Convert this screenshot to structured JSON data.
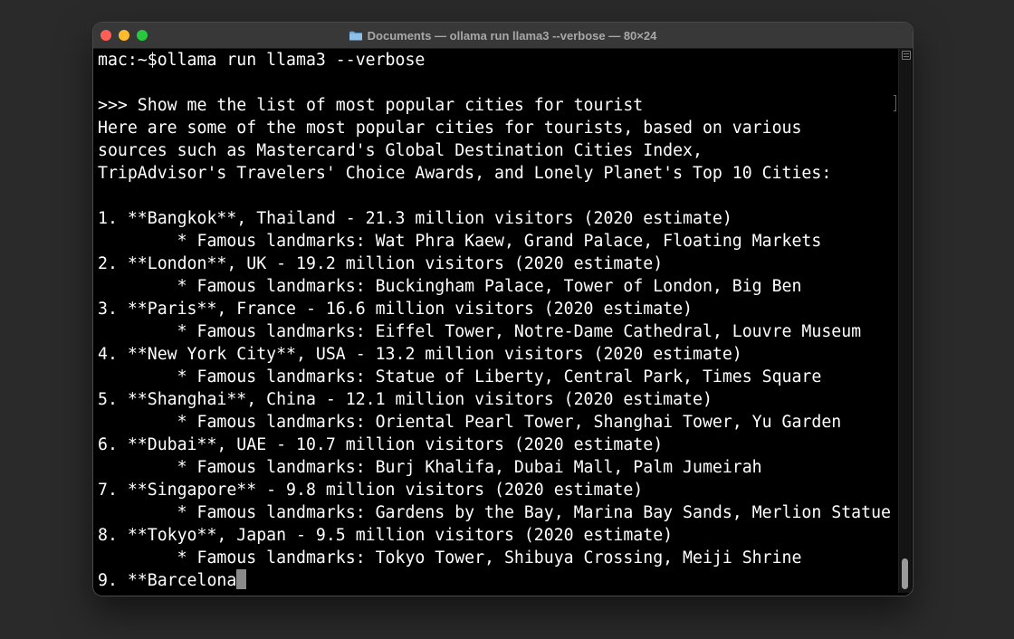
{
  "window": {
    "title": "Documents — ollama run llama3 --verbose — 80×24",
    "folder_icon": "folder-icon",
    "controls": {
      "close": "close-button",
      "minimize": "minimize-button",
      "zoom": "zoom-button"
    }
  },
  "colors": {
    "close": "#ff5f57",
    "minimize": "#febc2e",
    "zoom": "#28c840",
    "terminal_bg": "#000000",
    "terminal_fg": "#ffffff"
  },
  "terminal": {
    "lines": [
      "mac:~$ollama run llama3 --verbose",
      "",
      ">>> Show me the list of most popular cities for tourist",
      "Here are some of the most popular cities for tourists, based on various",
      "sources such as Mastercard's Global Destination Cities Index,",
      "TripAdvisor's Travelers' Choice Awards, and Lonely Planet's Top 10 Cities:",
      "",
      "1. **Bangkok**, Thailand - 21.3 million visitors (2020 estimate)",
      "        * Famous landmarks: Wat Phra Kaew, Grand Palace, Floating Markets",
      "2. **London**, UK - 19.2 million visitors (2020 estimate)",
      "        * Famous landmarks: Buckingham Palace, Tower of London, Big Ben",
      "3. **Paris**, France - 16.6 million visitors (2020 estimate)",
      "        * Famous landmarks: Eiffel Tower, Notre-Dame Cathedral, Louvre Museum",
      "4. **New York City**, USA - 13.2 million visitors (2020 estimate)",
      "        * Famous landmarks: Statue of Liberty, Central Park, Times Square",
      "5. **Shanghai**, China - 12.1 million visitors (2020 estimate)",
      "        * Famous landmarks: Oriental Pearl Tower, Shanghai Tower, Yu Garden",
      "6. **Dubai**, UAE - 10.7 million visitors (2020 estimate)",
      "        * Famous landmarks: Burj Khalifa, Dubai Mall, Palm Jumeirah",
      "7. **Singapore** - 9.8 million visitors (2020 estimate)",
      "        * Famous landmarks: Gardens by the Bay, Marina Bay Sands, Merlion Statue",
      "8. **Tokyo**, Japan - 9.5 million visitors (2020 estimate)",
      "        * Famous landmarks: Tokyo Tower, Shibuya Crossing, Meiji Shrine",
      "9. **Barcelona"
    ]
  }
}
